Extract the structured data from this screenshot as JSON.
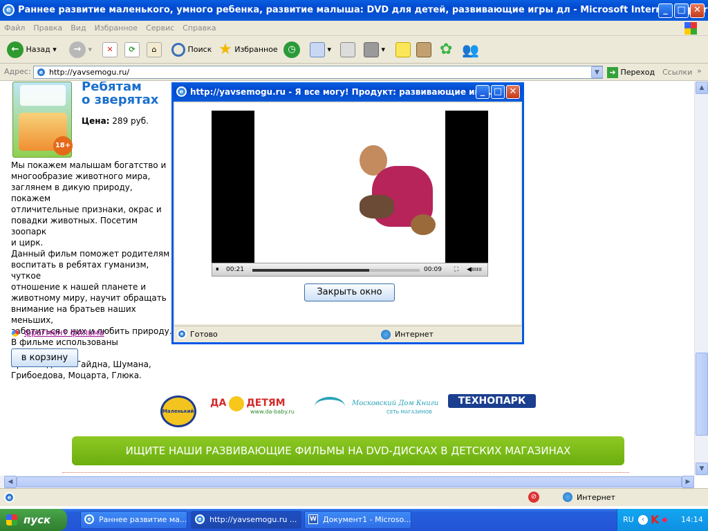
{
  "window": {
    "title": "Раннее развитие маленького, умного ребенка, развитие малыша: DVD для детей, развивающие игры дл - Microsoft Internet Explorer"
  },
  "menu": [
    "Файл",
    "Правка",
    "Вид",
    "Избранное",
    "Сервис",
    "Справка"
  ],
  "toolbar": {
    "back": "Назад",
    "search": "Поиск",
    "favorites": "Избранное"
  },
  "address": {
    "label": "Адрес:",
    "url": "http://yavsemogu.ru/",
    "go": "Переход",
    "links": "Ссылки"
  },
  "product": {
    "title_line1": "Ребятам",
    "title_line2": "о зверятах",
    "price_label": "Цена:",
    "price_value": "289 руб.",
    "box_badge": "18+",
    "description": [
      "Мы покажем малышам богатство и",
      "многообразие животного мира,",
      "заглянем в дикую природу, покажем",
      "отличительные признаки, окрас и",
      "повадки животных. Посетим зоопарк",
      "и цирк.",
      "Данный фильм поможет родителям",
      "воспитать в ребятах гуманизм, чуткое",
      "отношение к нашей планете и",
      "животному миру, научит обращать",
      "внимание на братьев наших меньших,",
      "заботиться о них и любить природу.",
      "В фильме использованы классические",
      "произведения Гайдна, Шумана,",
      "Грибоедова, Моцарта, Глюка."
    ],
    "fragment_link": "фрагмент фильма",
    "cart_button": "в корзину"
  },
  "partners": {
    "p1": "Маленький гений",
    "p2_a": "ДА",
    "p2_b": "ДЕТЯМ",
    "p2_url": "www.da-baby.ru",
    "p3_a": "Московский Дом Книги",
    "p3_b": "СЕТЬ МАГАЗИНОВ",
    "p4": "ТЕХНОПАРК"
  },
  "banner": "ИЩИТЕ НАШИ РАЗВИВАЮЩИЕ ФИЛЬМЫ НА DVD-ДИСКАХ В ДЕТСКИХ МАГАЗИНАХ",
  "popup": {
    "title": "http://yavsemogu.ru - Я все могу! Продукт: развивающие игр...",
    "elapsed": "00:21",
    "remaining": "00:09",
    "progress": 0.7,
    "close_button": "Закрыть окно",
    "status": "Готово",
    "zone": "Интернет"
  },
  "status": {
    "zone": "Интернет"
  },
  "taskbar": {
    "start": "пуск",
    "tasks": [
      "Раннее развитие ма...",
      "http://yavsemogu.ru ...",
      "Документ1 - Microso..."
    ],
    "lang": "RU",
    "clock": "14:14"
  }
}
